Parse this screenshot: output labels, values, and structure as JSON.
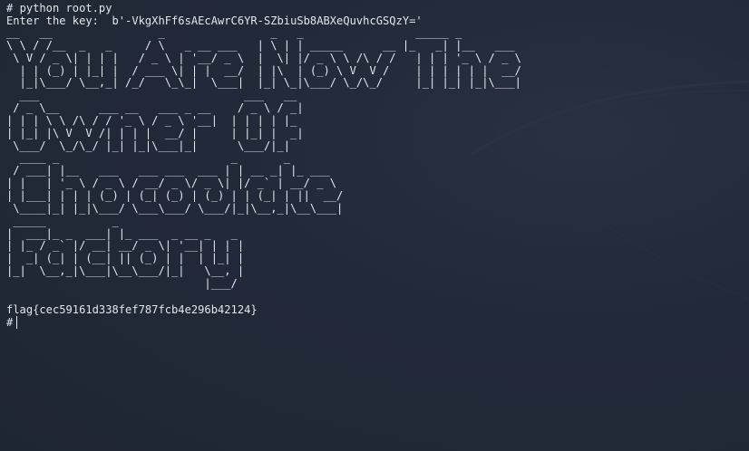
{
  "terminal": {
    "command_prompt": "#",
    "command": "python root.py",
    "key_label": "Enter the key:",
    "key_value": "b'-VkgXhFf6sAEcAwrC6YR-SZbiuSb8ABXeQuvhcGSQzY='",
    "banner_lines": [
      [
        "__   __                _                _   _                 _____ _          ",
        "\\ \\ / /__  _   _     / \\   _ __ ___   | \\ | | _____      __ |_   _| |__   ___ ",
        " \\ V / _ \\| | | |   / _ \\ | '__/ _ \\  |  \\| |/ _ \\ \\ /\\ / /   | | | '_ \\ / _ \\",
        "  | | (_) | |_| |  / ___ \\| | |  __/  | |\\  | (_) \\ V  V /    | | | | | |  __/",
        "  |_|\\___/ \\__,_| /_/   \\_\\_|  \\___|  |_| \\_|\\___/ \\_/\\_/     |_| |_| |_|\\___|"
      ],
      [
        "  ___                               ___   __ ",
        " / _ \\__      ___ __   ___ _ __    / _ \\ / _|",
        "| | | \\ \\ /\\ / / '_ \\ / _ \\ '__|  | | | | |_ ",
        "| |_| |\\ V  V /| | | |  __/ |     | |_| |  _|",
        " \\___/  \\_/\\_/ |_| |_|\\___|_|      \\___/|_|  "
      ],
      [
        "  ____ _                          _       _       ",
        " / ___| |__   ___   ___ ___  ___ | | __ _| |_ ___ ",
        "| |   | '_ \\ / _ \\ / __/ _ \\/ _ \\| |/ _` | __/ _ \\",
        "| |___| | | | (_) | (_| (_) | (_) | | (_| | ||  __/",
        " \\____|_| |_|\\___/ \\___\\___/ \\___/|_|\\__,_|\\__\\___|"
      ],
      [
        " _____          _                   ",
        "|  ___|_ _  ___| |_ ___  _ __ _   _ ",
        "| |_ / _` |/ __| __/ _ \\| '__| | | |",
        "|  _| (_| | (__| || (_) | |  | |_| |",
        "|_|  \\__,_|\\___|\\__\\___/|_|   \\__, |",
        "                              |___/ "
      ]
    ],
    "flag": "flag{cec59161d338fef787fcb4e296b42124}",
    "final_prompt": "#"
  },
  "colors": {
    "background": "#212836",
    "text": "#e3e6ea"
  }
}
